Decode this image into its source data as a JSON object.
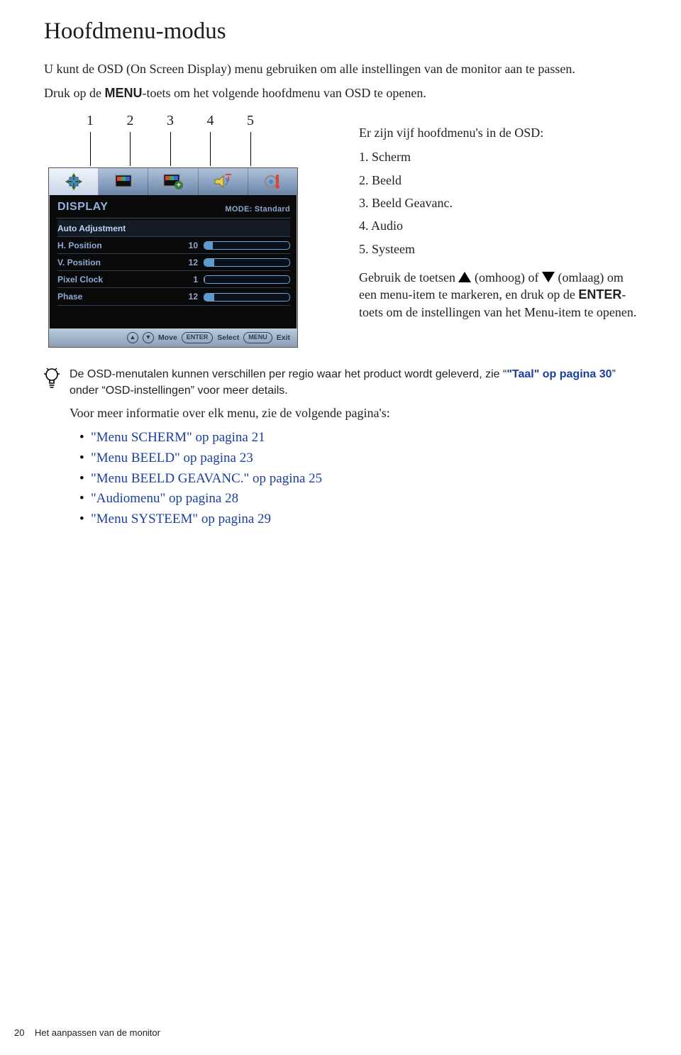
{
  "title": "Hoofdmenu-modus",
  "intro1_a": "U kunt de OSD (On Screen Display) menu gebruiken om alle instellingen van de monitor aan te passen.",
  "intro2_a": "Druk op de ",
  "intro2_menu": "MENU",
  "intro2_b": "-toets om het volgende hoofdmenu van OSD te openen.",
  "callouts": [
    "1",
    "2",
    "3",
    "4",
    "5"
  ],
  "osd": {
    "title": "DISPLAY",
    "mode_label": "MODE: Standard",
    "items": [
      {
        "label": "Auto Adjustment",
        "value": "",
        "pct": 0,
        "hasSlider": false,
        "selected": true
      },
      {
        "label": "H. Position",
        "value": "10",
        "pct": 10,
        "hasSlider": true,
        "selected": false
      },
      {
        "label": "V. Position",
        "value": "12",
        "pct": 12,
        "hasSlider": true,
        "selected": false
      },
      {
        "label": "Pixel Clock",
        "value": "1",
        "pct": 1,
        "hasSlider": true,
        "selected": false
      },
      {
        "label": "Phase",
        "value": "12",
        "pct": 12,
        "hasSlider": true,
        "selected": false
      }
    ],
    "footer": {
      "move": "Move",
      "enter": "ENTER",
      "select": "Select",
      "menu": "MENU",
      "exit": "Exit"
    }
  },
  "right": {
    "lead": "Er zijn vijf hoofdmenu's in de OSD:",
    "list": [
      "1. Scherm",
      "2. Beeld",
      "3. Beeld Geavanc.",
      "4. Audio",
      "5. Systeem"
    ],
    "instr_a": "Gebruik de toetsen ",
    "instr_b": " (omhoog) of ",
    "instr_c": " (omlaag) om een menu-item te markeren, en druk op de ",
    "instr_enter": "ENTER",
    "instr_d": "-toets om de instellingen van het Menu-item te openen."
  },
  "hint": {
    "note_a": "De OSD-menutalen kunnen verschillen per regio waar het product wordt geleverd, zie “",
    "note_link": "\"Taal\" op pagina 30",
    "note_b": "” onder “OSD-instellingen” voor meer details.",
    "more": "Voor meer informatie over elk menu, zie de volgende pagina's:",
    "links": [
      "\"Menu SCHERM\" op pagina 21",
      "\"Menu BEELD\" op pagina 23",
      "\"Menu BEELD GEAVANC.\" op pagina 25",
      "\"Audiomenu\" op pagina 28",
      "\"Menu SYSTEEM\" op pagina 29"
    ]
  },
  "footer": {
    "page": "20",
    "section": "Het aanpassen van de monitor"
  }
}
